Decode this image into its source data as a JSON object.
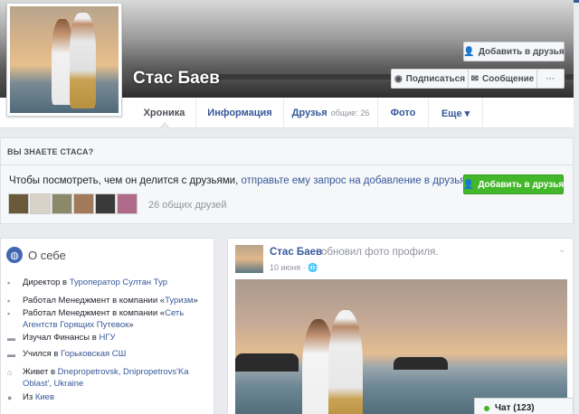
{
  "profile": {
    "name": "Стас Баев",
    "buttons": {
      "add_friend": "Добавить в друзья",
      "subscribe": "Подписаться",
      "message": "Сообщение",
      "more": "···"
    }
  },
  "tabs": [
    {
      "label": "Хроника"
    },
    {
      "label": "Информация"
    },
    {
      "label": "Друзья",
      "sub": "общие: 26"
    },
    {
      "label": "Фото"
    },
    {
      "label": "Еще ▾"
    }
  ],
  "know": {
    "heading": "ВЫ ЗНАЕТЕ СТАСА?",
    "text_plain": "Чтобы посмотреть, чем он делится с друзьями, ",
    "text_link": "отправьте ему запрос на добавление в друзья.",
    "button": "Добавить в друзья",
    "mutual": "26 общих друзей",
    "friend_colors": [
      "#6b5a3a",
      "#d8d2c8",
      "#8a8a6a",
      "#a07a5a",
      "#3a3a3a",
      "#b06a8a"
    ]
  },
  "about": {
    "title": "О себе",
    "rows": [
      {
        "pre": "Директор в ",
        "link": "Туроператор Султан Тур",
        "post": ""
      },
      {
        "pre": "Работал Менеджмент в компании «",
        "link": "Туризм",
        "post": "»"
      },
      {
        "pre": "Работал Менеджмент в компании «",
        "link": "Сеть Агентств Горящих Путевок",
        "post": "»"
      },
      {
        "pre": "Изучал Финансы в ",
        "link": "НГУ",
        "post": ""
      },
      {
        "pre": "Учился в ",
        "link": "Горьковская СШ",
        "post": ""
      },
      {
        "pre": "Живет в ",
        "link": "Dnepropetrovsk, Dnipropetrovs'Ka Oblast', Ukraine",
        "post": ""
      },
      {
        "pre": "Из ",
        "link": "Киев",
        "post": ""
      }
    ]
  },
  "post": {
    "author": "Стас Баев",
    "action": "обновил фото профиля.",
    "date": "10 июня · ",
    "globe": "🌐"
  },
  "chat": {
    "label": "Чат (123)"
  },
  "colors": {
    "brand": "#3b5998",
    "link": "#365899",
    "green": "#42b72a"
  }
}
